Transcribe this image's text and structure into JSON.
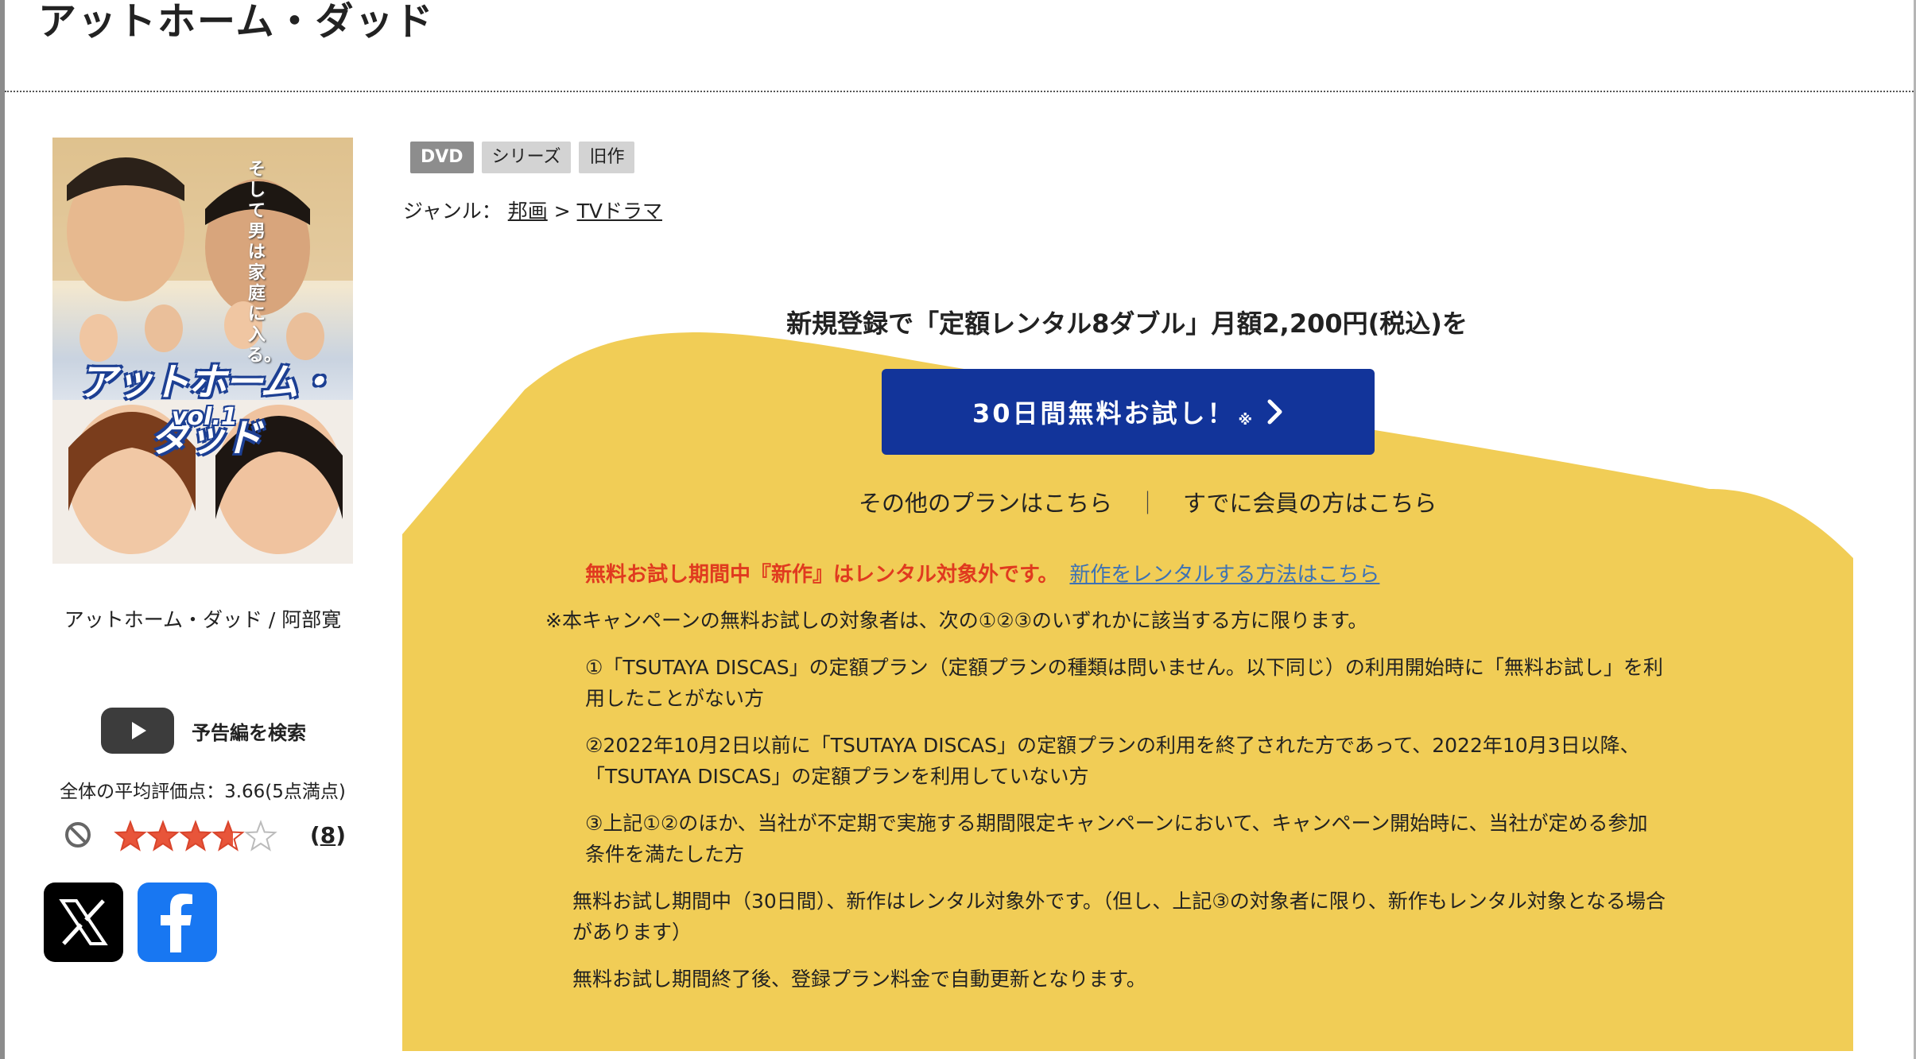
{
  "page": {
    "title": "アットホーム・ダッド"
  },
  "poster": {
    "title_art": "アットホーム・ダッド",
    "vol": "vol.1",
    "tagline": "そして男は家庭に入る。"
  },
  "caption": "アットホーム・ダッド / 阿部寛",
  "trailer": {
    "label": "予告編を検索",
    "icon": "play-icon"
  },
  "rating": {
    "label": "全体の平均評価点：",
    "value": "3.66(5点満点)",
    "score": 3.66,
    "max": 5,
    "count": "8",
    "count_open": "(",
    "count_close": ")"
  },
  "share": {
    "x_icon": "x-logo-icon",
    "facebook_icon": "facebook-logo-icon"
  },
  "tags": [
    "DVD",
    "シリーズ",
    "旧作"
  ],
  "genre": {
    "label": "ジャンル：",
    "items": [
      "邦画",
      "TVドラマ"
    ],
    "separator": ">"
  },
  "campaign": {
    "headline": "新規登録で「定額レンタル8ダブル」月額2,200円(税込)を",
    "button_label": "30日間無料お試し！",
    "button_note": "※",
    "other_plans": "その他のプランはこちら",
    "separator": "｜",
    "members": "すでに会員の方はこちら",
    "warning": "無料お試し期間中『新作』はレンタル対象外です。",
    "warning_link": "新作をレンタルする方法はこちら",
    "note_lead": "※本キャンペーンの無料お試しの対象者は、次の①②③のいずれかに該当する方に限ります。",
    "conditions": [
      [
        "①「TSUTAYA DISCAS」の定額プラン（定額プランの種類は問いません。以下同じ）の利用開始時に「無料お試し」を利",
        "用したことがない方"
      ],
      [
        "②2022年10月2日以前に「TSUTAYA DISCAS」の定額プランの利用を終了された方であって、2022年10月3日以降、",
        "「TSUTAYA DISCAS」の定額プランを利用していない方"
      ],
      [
        "③上記①②のほか、当社が不定期で実施する期間限定キャンペーンにおいて、キャンペーン開始時に、当社が定める参加",
        "条件を満たした方"
      ]
    ],
    "note_new": [
      "無料お試し期間中（30日間）、新作はレンタル対象外です。（但し、上記③の対象者に限り、新作もレンタル対象となる場合",
      "があります）"
    ],
    "note_renew": "無料お試し期間終了後、登録プラン料金で自動更新となります。",
    "colors": {
      "background": "#f1cd56",
      "button": "#12349a",
      "warning": "#e03a1f",
      "link": "#3e72b3"
    }
  }
}
